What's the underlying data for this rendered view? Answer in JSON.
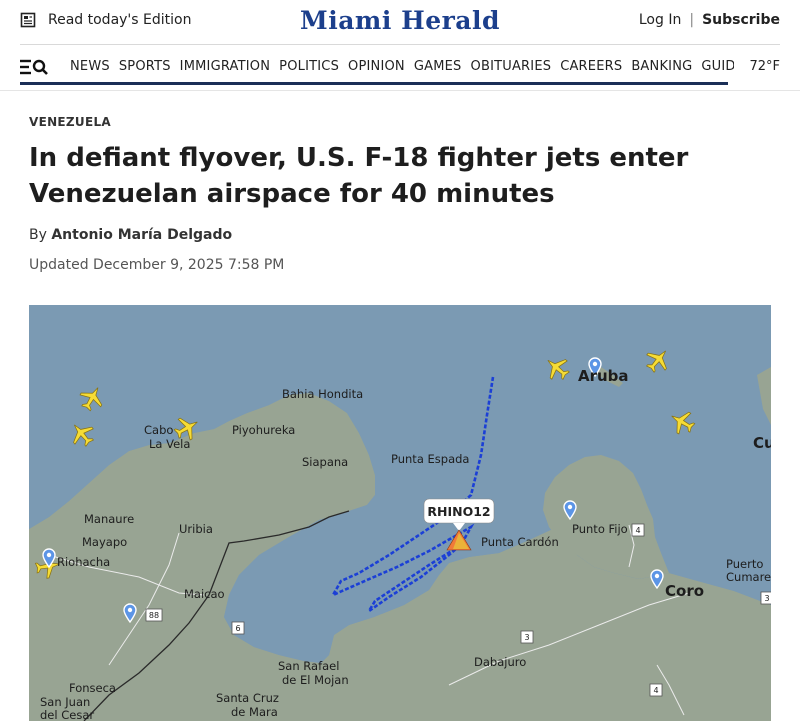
{
  "header": {
    "edition_label": "Read today's Edition",
    "masthead": "Miami Herald",
    "login_label": "Log In",
    "separator": "|",
    "subscribe_label": "Subscribe"
  },
  "nav": {
    "items": [
      "NEWS",
      "SPORTS",
      "IMMIGRATION",
      "POLITICS",
      "OPINION",
      "GAMES",
      "OBITUARIES",
      "CAREERS",
      "BANKING",
      "GUIDES"
    ],
    "temperature": "72°F"
  },
  "article": {
    "section": "VENEZUELA",
    "title_line1": "In defiant flyover, U.S. F-18 fighter jets enter",
    "title_line2": "Venezuelan airspace for 40 minutes",
    "byline_prefix": "By",
    "author": "Antonio María Delgado",
    "updated": "Updated December 9, 2025 7:58 PM"
  },
  "map": {
    "callsign": "RHINO12",
    "places": [
      "Bahia Hondita",
      "Cabo",
      "La Vela",
      "Piyohureka",
      "Siapana",
      "Punta Espada",
      "Aruba",
      "Manaure",
      "Uribia",
      "Mayapo",
      "Riohacha",
      "Maicao",
      "Punto Fijo",
      "Punta Cardón",
      "Puerto",
      "Cumarebo",
      "Coro",
      "San Rafael",
      "de El Mojan",
      "Dabajuro",
      "Fonseca",
      "San Juan",
      "del Cesar",
      "Santa Cruz",
      "de Mara",
      "Cu"
    ],
    "road_numbers": [
      "88",
      "6",
      "3",
      "4",
      "4",
      "3"
    ],
    "colors": {
      "sea": "#7b9ab3",
      "land": "#9aa595",
      "track": "#1b3fd6",
      "aircraft": "#f5dc3a",
      "pin": "#3b7de0"
    }
  }
}
